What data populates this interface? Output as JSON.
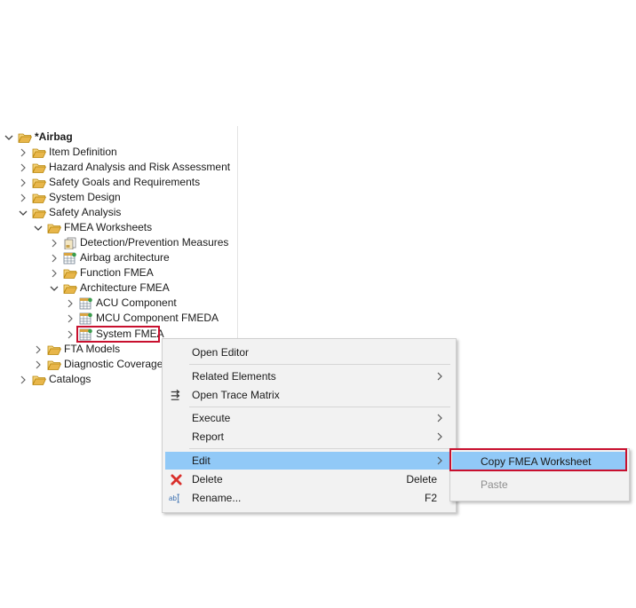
{
  "tree": {
    "root": {
      "label": "*Airbag",
      "icon": "open-folder-icon"
    },
    "items": [
      {
        "label": "Item Definition",
        "icon": "folder-icon"
      },
      {
        "label": "Hazard Analysis and Risk Assessment",
        "icon": "folder-icon"
      },
      {
        "label": "Safety Goals and Requirements",
        "icon": "folder-icon"
      },
      {
        "label": "System Design",
        "icon": "folder-icon"
      },
      {
        "label": "Safety Analysis",
        "icon": "open-folder-icon"
      },
      {
        "label": "FMEA Worksheets",
        "icon": "open-folder-icon"
      },
      {
        "label": "Detection/Prevention Measures",
        "icon": "document-stack-icon"
      },
      {
        "label": "Airbag architecture",
        "icon": "worksheet-icon"
      },
      {
        "label": "Function FMEA",
        "icon": "folder-icon"
      },
      {
        "label": "Architecture FMEA",
        "icon": "open-folder-icon"
      },
      {
        "label": "ACU Component",
        "icon": "worksheet-icon"
      },
      {
        "label": "MCU Component FMEDA",
        "icon": "worksheet-icon"
      },
      {
        "label": "System FMEA",
        "icon": "worksheet-icon"
      },
      {
        "label": "FTA Models",
        "icon": "folder-icon"
      },
      {
        "label": "Diagnostic Coverage",
        "icon": "folder-icon"
      },
      {
        "label": "Catalogs",
        "icon": "folder-icon"
      }
    ]
  },
  "context_menu": {
    "open_editor": "Open Editor",
    "related_elements": "Related Elements",
    "open_trace_matrix": "Open Trace Matrix",
    "execute": "Execute",
    "report": "Report",
    "edit": "Edit",
    "delete": "Delete",
    "delete_shortcut": "Delete",
    "rename": "Rename...",
    "rename_shortcut": "F2"
  },
  "submenu": {
    "copy_fmea_worksheet": "Copy FMEA Worksheet",
    "paste": "Paste"
  },
  "colors": {
    "highlight": "#91c9f7",
    "callout": "#c8102e",
    "folder": "#e8b64a",
    "delete_icon": "#d9302c"
  }
}
